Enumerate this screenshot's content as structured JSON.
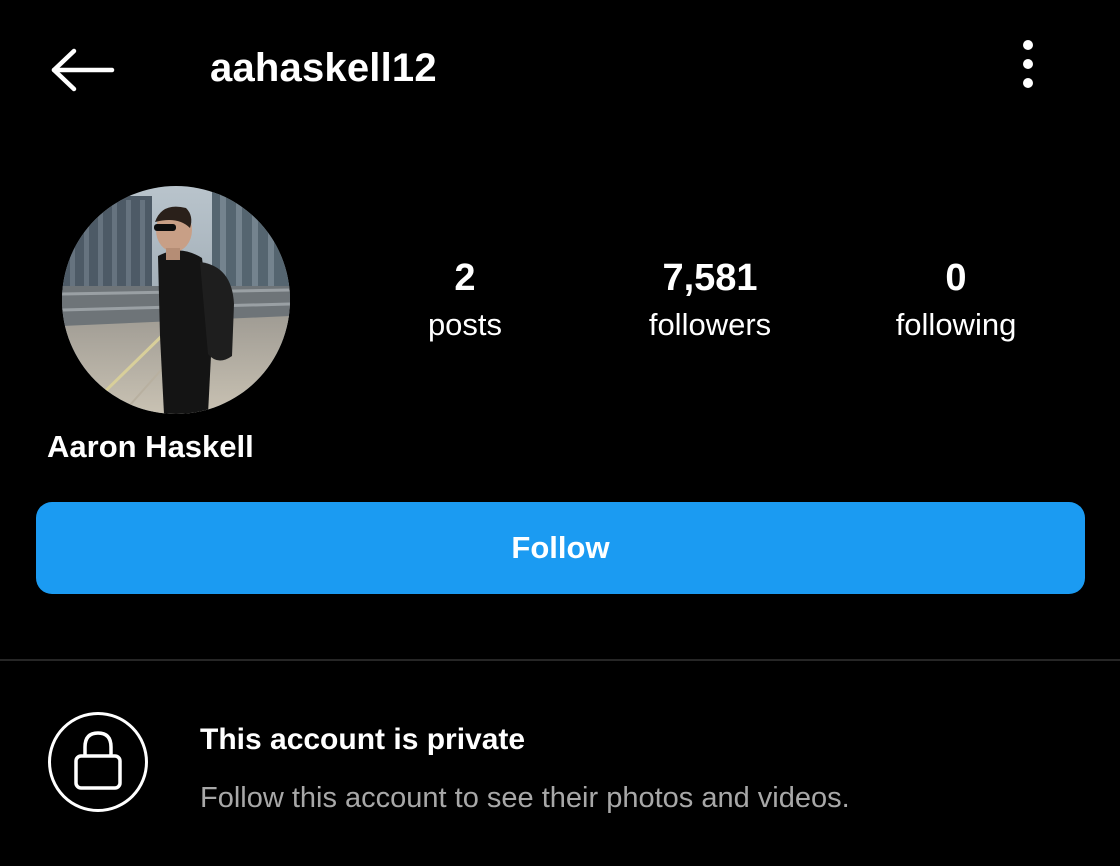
{
  "header": {
    "username": "aahaskell12",
    "back_icon": "arrow-left-icon",
    "menu_icon": "vertical-ellipsis-icon"
  },
  "profile": {
    "full_name": "Aaron Haskell",
    "avatar_icon": "profile-photo",
    "stats": {
      "posts": {
        "count": "2",
        "label": "posts"
      },
      "followers": {
        "count": "7,581",
        "label": "followers"
      },
      "following": {
        "count": "0",
        "label": "following"
      }
    }
  },
  "actions": {
    "follow_label": "Follow"
  },
  "private_notice": {
    "title": "This account is private",
    "subtitle": "Follow this account to see their photos and videos.",
    "icon": "lock-icon"
  },
  "colors": {
    "background": "#000000",
    "accent": "#1b9bf2",
    "text_primary": "#ffffff",
    "text_secondary": "#a8a8a8",
    "divider": "#262626"
  }
}
